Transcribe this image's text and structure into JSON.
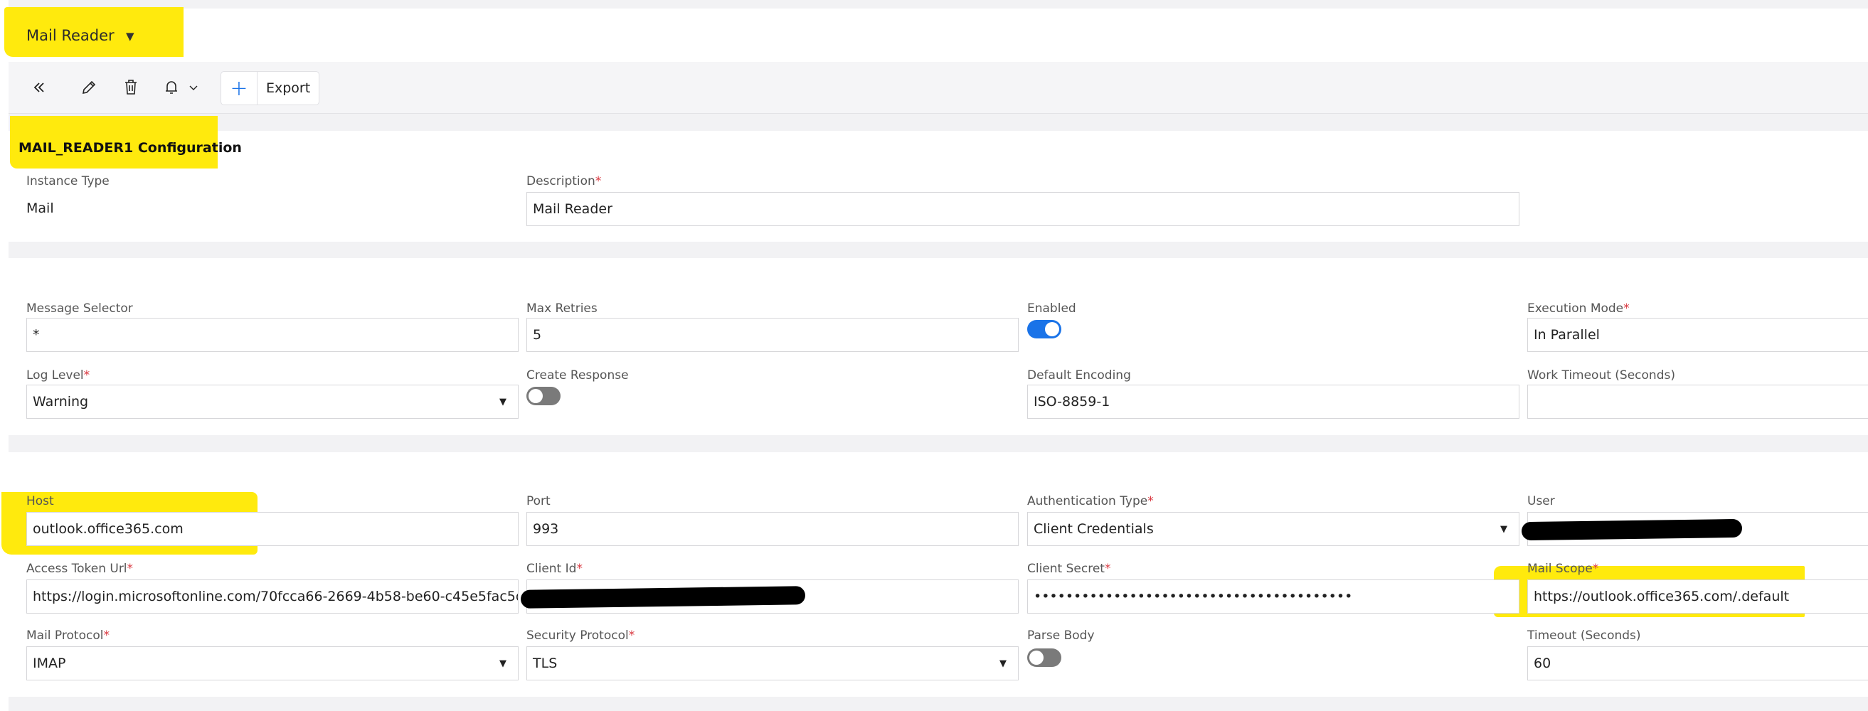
{
  "header": {
    "title": "Mail Reader",
    "caret_icon": "caret-down-icon"
  },
  "toolbar": {
    "icons": [
      "double-chevron-left-icon",
      "pencil-icon",
      "trash-icon",
      "bell-icon",
      "chevron-down-icon",
      "plus-icon"
    ],
    "export_label": "Export"
  },
  "config": {
    "title": "MAIL_READER1 Configuration",
    "instance_type_label": "Instance Type",
    "instance_type_value": "Mail",
    "description_label": "Description",
    "description_value": "Mail Reader"
  },
  "colors": {
    "accent": "#1a73e8",
    "required": "#d9363e",
    "highlight": "#ffe900",
    "toggle_off": "#7a7a7a"
  },
  "fields": {
    "message_selector": {
      "label": "Message Selector",
      "required": false,
      "type": "text",
      "value": "*"
    },
    "max_retries": {
      "label": "Max Retries",
      "required": false,
      "type": "text",
      "value": "5"
    },
    "enabled": {
      "label": "Enabled",
      "required": false,
      "type": "toggle",
      "on": true
    },
    "execution_mode": {
      "label": "Execution Mode",
      "required": true,
      "type": "text",
      "value": "In Parallel"
    },
    "log_level": {
      "label": "Log Level",
      "required": true,
      "type": "select",
      "value": "Warning"
    },
    "create_response": {
      "label": "Create Response",
      "required": false,
      "type": "toggle",
      "on": false
    },
    "default_encoding": {
      "label": "Default Encoding",
      "required": false,
      "type": "text",
      "value": "ISO-8859-1"
    },
    "work_timeout": {
      "label": "Work Timeout (Seconds)",
      "required": false,
      "type": "text",
      "value": ""
    },
    "host": {
      "label": "Host",
      "required": false,
      "type": "text",
      "value": "outlook.office365.com"
    },
    "port": {
      "label": "Port",
      "required": false,
      "type": "text",
      "value": "993"
    },
    "auth_type": {
      "label": "Authentication Type",
      "required": true,
      "type": "select",
      "value": "Client Credentials"
    },
    "user": {
      "label": "User",
      "required": false,
      "type": "text",
      "value": "",
      "redacted": true
    },
    "access_token_url": {
      "label": "Access Token Url",
      "required": true,
      "type": "text",
      "value": "https://login.microsoftonline.com/70fcca66-2669-4b58-be60-c45e5fac5d..."
    },
    "client_id": {
      "label": "Client Id",
      "required": true,
      "type": "text",
      "value": "",
      "redacted": true
    },
    "client_secret": {
      "label": "Client Secret",
      "required": true,
      "type": "password",
      "value": "••••••••••••••••••••••••••••••••••••••••"
    },
    "mail_scope": {
      "label": "Mail Scope",
      "required": true,
      "type": "text",
      "value": "https://outlook.office365.com/.default"
    },
    "mail_protocol": {
      "label": "Mail Protocol",
      "required": true,
      "type": "select",
      "value": "IMAP"
    },
    "security_protocol": {
      "label": "Security Protocol",
      "required": true,
      "type": "select",
      "value": "TLS"
    },
    "parse_body": {
      "label": "Parse Body",
      "required": false,
      "type": "toggle",
      "on": false
    },
    "timeout": {
      "label": "Timeout (Seconds)",
      "required": false,
      "type": "text",
      "value": "60"
    }
  }
}
